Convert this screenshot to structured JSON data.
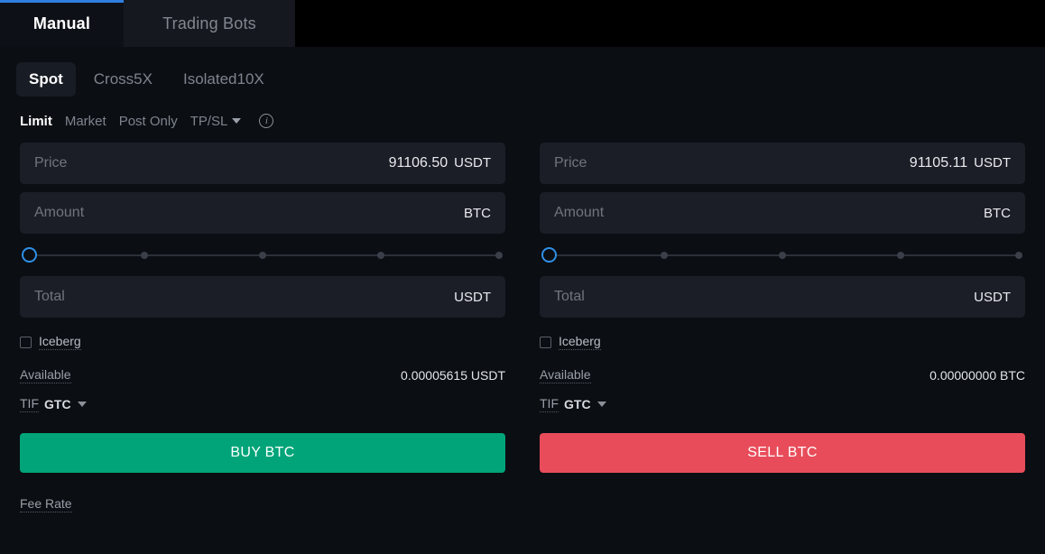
{
  "tabs": [
    {
      "label": "Manual",
      "active": true
    },
    {
      "label": "Trading Bots",
      "active": false
    }
  ],
  "margin_modes": [
    {
      "label": "Spot",
      "active": true
    },
    {
      "label": "Cross5X",
      "active": false
    },
    {
      "label": "Isolated10X",
      "active": false
    }
  ],
  "order_types": [
    {
      "label": "Limit",
      "active": true
    },
    {
      "label": "Market",
      "active": false
    },
    {
      "label": "Post Only",
      "active": false
    }
  ],
  "tpsl": {
    "label": "TP/SL",
    "caret": "chevron-down-icon",
    "info": "info-icon"
  },
  "buy": {
    "price": {
      "placeholder": "Price",
      "value": "91106.50",
      "unit": "USDT"
    },
    "amount": {
      "placeholder": "Amount",
      "value": "",
      "unit": "BTC"
    },
    "total": {
      "placeholder": "Total",
      "value": "",
      "unit": "USDT"
    },
    "slider": {
      "value": 0,
      "marks": [
        0,
        25,
        50,
        75,
        100
      ]
    },
    "iceberg": {
      "label": "Iceberg",
      "checked": false
    },
    "available": {
      "label": "Available",
      "value": "0.00005615 USDT"
    },
    "tif": {
      "label": "TIF",
      "value": "GTC"
    },
    "action": {
      "label": "BUY BTC",
      "color": "#00a478"
    }
  },
  "sell": {
    "price": {
      "placeholder": "Price",
      "value": "91105.11",
      "unit": "USDT"
    },
    "amount": {
      "placeholder": "Amount",
      "value": "",
      "unit": "BTC"
    },
    "total": {
      "placeholder": "Total",
      "value": "",
      "unit": "USDT"
    },
    "slider": {
      "value": 0,
      "marks": [
        0,
        25,
        50,
        75,
        100
      ]
    },
    "iceberg": {
      "label": "Iceberg",
      "checked": false
    },
    "available": {
      "label": "Available",
      "value": "0.00000000 BTC"
    },
    "tif": {
      "label": "TIF",
      "value": "GTC"
    },
    "action": {
      "label": "SELL BTC",
      "color": "#e84c5a"
    }
  },
  "footer": {
    "fee_rate": "Fee Rate"
  },
  "colors": {
    "accent_blue": "#2f7fe0",
    "buy_green": "#00a478",
    "sell_red": "#e84c5a",
    "field_bg": "#1b1e26",
    "page_bg": "#0b0e13"
  }
}
